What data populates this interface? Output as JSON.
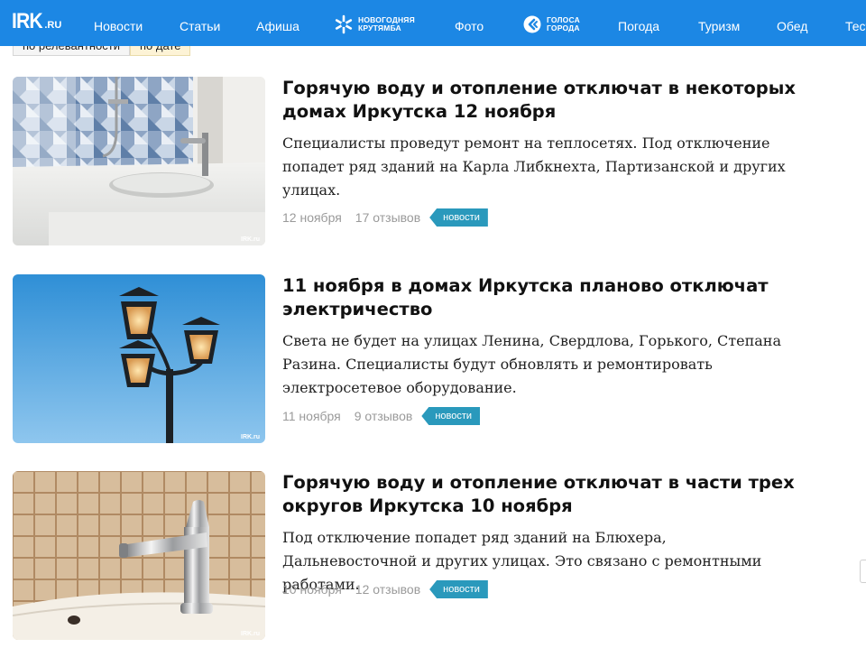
{
  "header": {
    "logo": {
      "main": "IRK",
      "suffix": ".RU"
    },
    "nav": [
      {
        "label": "Новости"
      },
      {
        "label": "Статьи"
      },
      {
        "label": "Афиша"
      },
      {
        "label": "Фото"
      },
      {
        "label": "Погода"
      },
      {
        "label": "Туризм"
      },
      {
        "label": "Обед"
      },
      {
        "label": "Тест"
      }
    ],
    "special_new_year": {
      "line1": "Новогодняя",
      "line2": "крутямба",
      "icon": "snowflake-icon"
    },
    "special_voices": {
      "line1": "Голоса",
      "line2": "города",
      "icon": "quote-bubble-icon"
    },
    "colors": {
      "bar": "#1c87e4",
      "tag": "#2a99bc",
      "active_sort": "#fdf3d6"
    }
  },
  "sort": {
    "buttons": [
      {
        "label": "по релевантности",
        "active": false
      },
      {
        "label": "по дате",
        "active": true
      }
    ]
  },
  "news": [
    {
      "title": "Горячую воду и отопление отключат в некоторых домах Иркутска 12 ноября",
      "lead": "Специалисты проведут ремонт на теплосетях. Под отключение попадет ряд зданий на Карла Либкнехта, Партизанской и других улицах.",
      "date": "12 ноября",
      "comments": "17 отзывов",
      "tag": "новости",
      "image": "bathroom-sink-photo",
      "watermark": "IRK.ru"
    },
    {
      "title": "11 ноября в домах Иркутска планово отключат электричество",
      "lead": "Света не будет на улицах Ленина, Свердлова, Горького, Степана Разина. Специалисты будут обновлять и ремонтировать электросетевое оборудование.",
      "date": "11 ноября",
      "comments": "9 отзывов",
      "tag": "новости",
      "image": "street-lamp-photo",
      "watermark": "IRK.ru"
    },
    {
      "title": "Горячую воду и отопление отключат в части трех округов Иркутска 10 ноября",
      "lead": "Под отключение попадет ряд зданий на Блюхера, Дальневосточной и других улицах. Это связано с ремонтными работами.",
      "date": "10 ноября",
      "comments": "12 отзывов",
      "tag": "новости",
      "image": "chrome-faucet-photo",
      "watermark": "IRK.ru"
    }
  ]
}
